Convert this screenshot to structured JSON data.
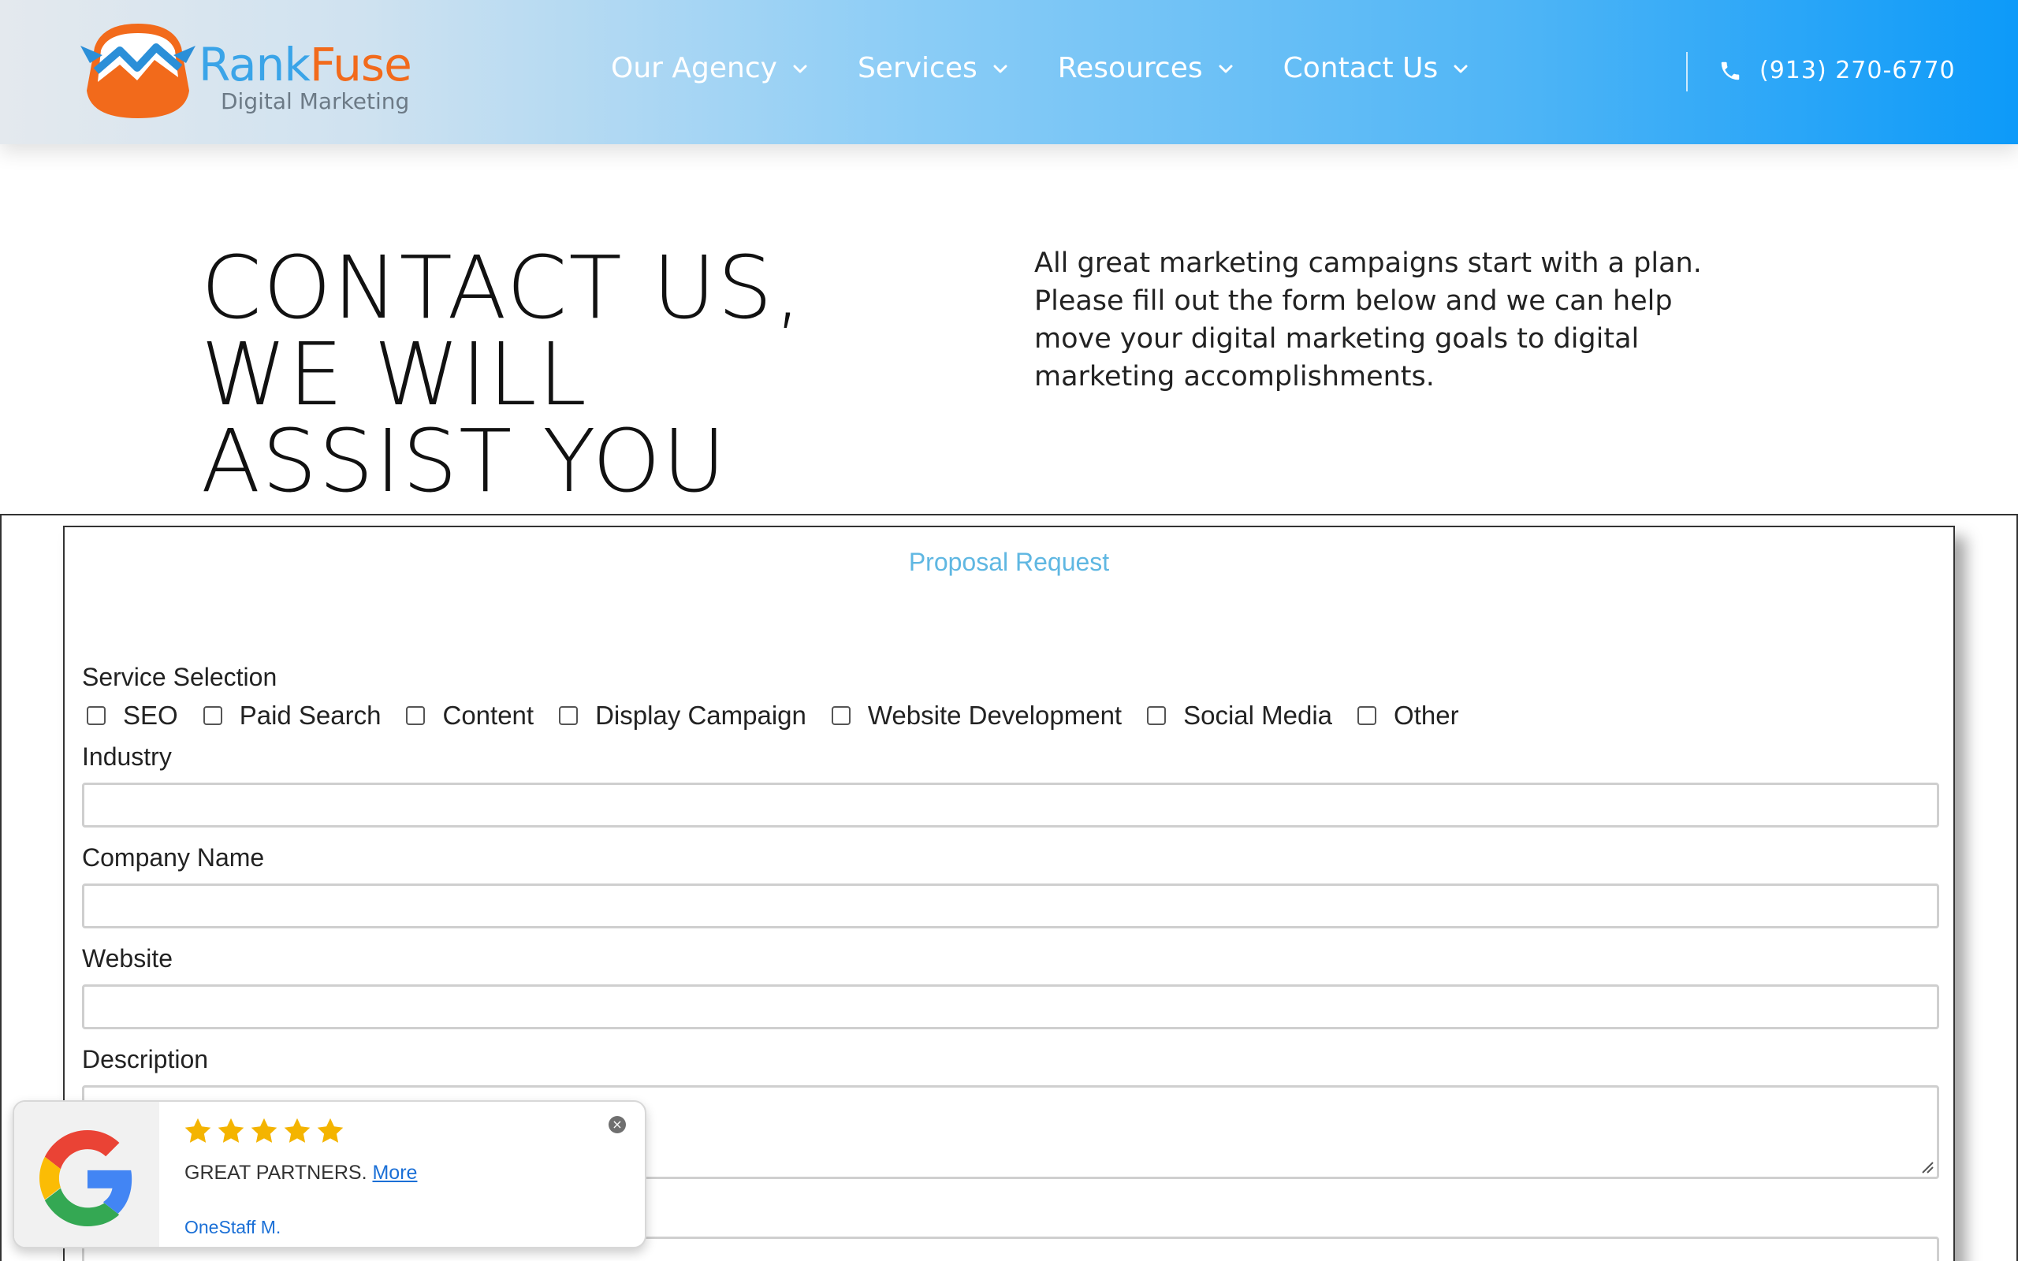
{
  "header": {
    "logo": {
      "name_part1": "Rank",
      "name_part2": "Fuse",
      "tagline": "Digital Marketing"
    },
    "nav": [
      {
        "label": "Our Agency"
      },
      {
        "label": "Services"
      },
      {
        "label": "Resources"
      },
      {
        "label": "Contact Us"
      }
    ],
    "phone": "(913) 270-6770",
    "icons": {
      "dropdown": "chevron-down-icon",
      "phone": "phone-icon"
    },
    "colors": {
      "gradient_start": "#e4e9ee",
      "gradient_end": "#0d9af9",
      "logo_blue": "#3aa4e8",
      "logo_orange": "#f26a1b"
    }
  },
  "hero": {
    "title_lines": [
      "CONTACT US,",
      "WE WILL",
      "ASSIST YOU"
    ],
    "copy": "All great marketing campaigns start with a plan. Please fill out the form below and we can help move your digital marketing goals to digital marketing accomplishments."
  },
  "form": {
    "title": "Proposal Request",
    "service_selection_label": "Service Selection",
    "services": [
      "SEO",
      "Paid Search",
      "Content",
      "Display Campaign",
      "Website Development",
      "Social Media",
      "Other"
    ],
    "fields": {
      "industry": {
        "label": "Industry",
        "value": ""
      },
      "company_name": {
        "label": "Company Name",
        "value": ""
      },
      "website": {
        "label": "Website",
        "value": ""
      },
      "description": {
        "label": "Description",
        "value": ""
      }
    },
    "colors": {
      "title": "#5fb7e2"
    }
  },
  "review": {
    "rating": 5,
    "text": "GREAT PARTNERS.",
    "more_label": "More",
    "author": "OneStaff M.",
    "icons": {
      "brand": "google-g-icon",
      "star": "star-icon",
      "close": "close-icon"
    },
    "colors": {
      "star": "#f4b400",
      "link": "#1a6fd6"
    }
  }
}
